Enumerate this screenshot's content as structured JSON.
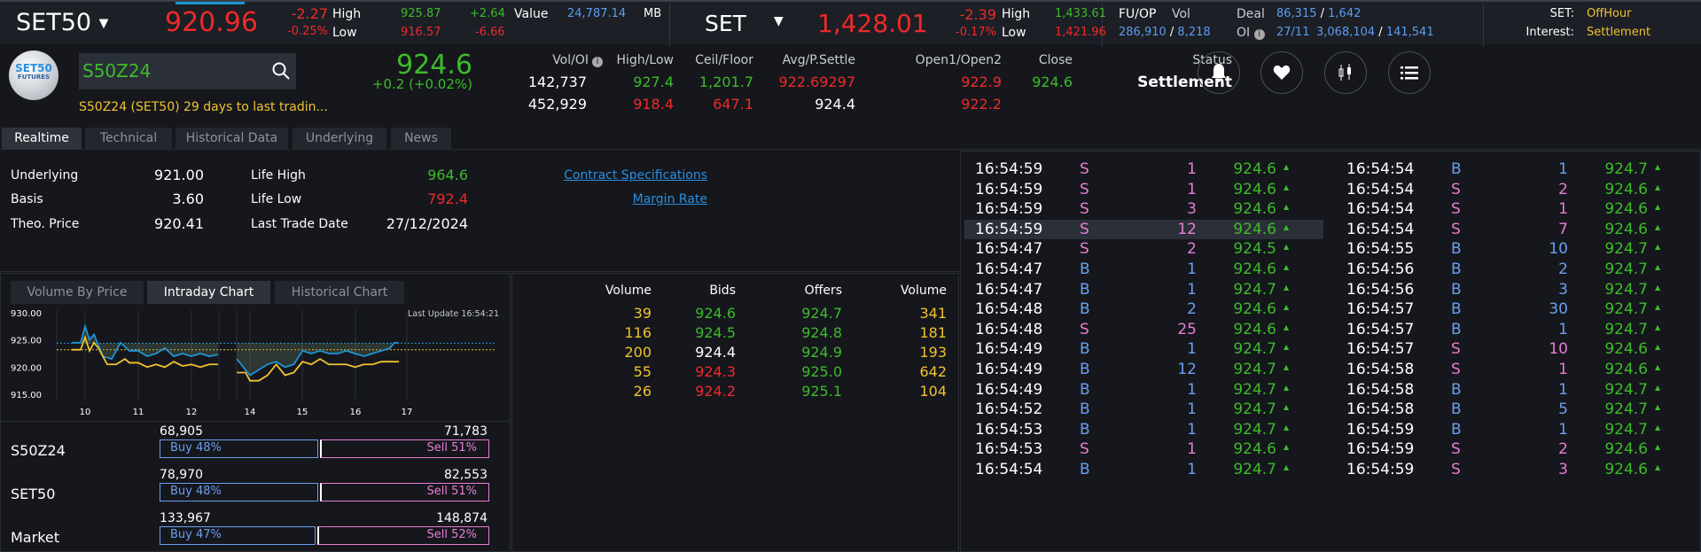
{
  "top": {
    "set50": {
      "name": "SET50",
      "last": "920.96",
      "chg": "-2.27",
      "pct": "-0.25%",
      "high_label": "High",
      "low_label": "Low",
      "high": "925.87",
      "low": "916.57",
      "high_chg": "+2.64",
      "low_chg": "-6.66",
      "value_label": "Value",
      "value": "24,787.14",
      "unit": "MB"
    },
    "set": {
      "name": "SET",
      "last": "1,428.01",
      "chg": "-2.39",
      "pct": "-0.17%",
      "high_label": "High",
      "low_label": "Low",
      "high": "1,433.61",
      "low": "1,421.96"
    },
    "fuop": {
      "label": "FU/OP",
      "vol_label": "Vol",
      "vol": "286,910",
      "vol2": "8,218",
      "deal_label": "Deal",
      "deal": "86,315",
      "deal2": "1,642",
      "oi_label": "OI",
      "oi_date": "27/11",
      "oi": "3,068,104",
      "oi2": "141,541"
    },
    "status": {
      "set_label": "SET:",
      "set_value": "OffHour",
      "interest_label": "Interest:",
      "interest_value": "Settlement"
    }
  },
  "symbol": {
    "logo_top": "SET50",
    "logo_bottom": "FUTURES",
    "search_value": "S50Z24",
    "desc": "S50Z24 (SET50) 29 days to last tradin...",
    "price": "924.6",
    "change": "+0.2 (+0.02%)"
  },
  "stats": {
    "headers": [
      "Vol/OI",
      "High/Low",
      "Ceil/Floor",
      "Avg/P.Settle",
      "Open1/Open2",
      "Close",
      "Status"
    ],
    "vol": "142,737",
    "oi": "452,929",
    "high": "927.4",
    "low": "918.4",
    "ceil": "1,201.7",
    "floor": "647.1",
    "avg": "922.69297",
    "psettle": "924.4",
    "open1": "922.9",
    "open2": "922.2",
    "close": "924.6",
    "status": "Settlement"
  },
  "icons": [
    "bell-icon",
    "heart-icon",
    "candlestick-icon",
    "list-icon"
  ],
  "tabs": [
    "Realtime",
    "Technical",
    "Historical Data",
    "Underlying",
    "News"
  ],
  "info": {
    "underlying_label": "Underlying",
    "underlying": "921.00",
    "basis_label": "Basis",
    "basis": "3.60",
    "theo_label": "Theo. Price",
    "theo": "920.41",
    "life_high_label": "Life High",
    "life_high": "964.6",
    "life_low_label": "Life Low",
    "life_low": "792.4",
    "ltd_label": "Last Trade Date",
    "ltd": "27/12/2024",
    "contract_link": "Contract Specifications",
    "margin_link": "Margin Rate"
  },
  "chart_tabs": [
    "Volume By Price",
    "Intraday Chart",
    "Historical Chart"
  ],
  "chart_data": {
    "type": "line",
    "last_update": "Last Update 16:54:21",
    "ylim": [
      915,
      930
    ],
    "yticks": [
      "930.00",
      "925.00",
      "920.00",
      "915.00"
    ],
    "xticks": [
      "10",
      "11",
      "12",
      "14",
      "15",
      "16",
      "17"
    ],
    "grid": true,
    "colors": {
      "series1": "#1e94d6",
      "series2": "#f2c230"
    },
    "ref_lines": [
      924.4,
      923.2
    ],
    "series": [
      {
        "x": [
          "9:45",
          "9:55",
          "10:00",
          "10:05",
          "10:10",
          "10:15",
          "10:20",
          "10:30",
          "10:40",
          "10:50",
          "11:00",
          "11:10",
          "11:20",
          "11:30",
          "11:40",
          "11:50",
          "12:00",
          "12:10",
          "12:20",
          "12:30",
          null,
          "13:45",
          "13:55",
          "14:00",
          "14:10",
          "14:20",
          "14:30",
          "14:40",
          "14:50",
          "15:00",
          "15:10",
          "15:20",
          "15:30",
          "15:40",
          "15:50",
          "16:00",
          "16:10",
          "16:20",
          "16:30",
          "16:40",
          "16:45",
          "16:50"
        ],
        "values": [
          924.5,
          924.5,
          927.5,
          925,
          926,
          924,
          922,
          921.5,
          924.5,
          923,
          923,
          922,
          922.5,
          923.5,
          922,
          922.5,
          922,
          922.5,
          922,
          922.3,
          null,
          921.5,
          919.5,
          918.5,
          919.5,
          920.5,
          921,
          920,
          920.5,
          923,
          922.5,
          923,
          922.5,
          922.5,
          923,
          922.5,
          922,
          922.5,
          923,
          923.5,
          924.5,
          924.4
        ]
      },
      {
        "x": [
          "9:45",
          "9:55",
          "10:00",
          "10:05",
          "10:10",
          "10:15",
          "10:20",
          "10:25",
          "10:35",
          "10:45",
          "10:50",
          "11:00",
          "11:10",
          "11:20",
          "11:30",
          "11:40",
          "11:50",
          "12:00",
          "12:10",
          "12:20",
          "12:30",
          null,
          "13:45",
          "13:55",
          "14:00",
          "14:10",
          "14:20",
          "14:30",
          "14:40",
          "14:50",
          "15:00",
          "15:10",
          "15:20",
          "15:30",
          "15:40",
          "15:50",
          "16:00",
          "16:10",
          "16:20",
          "16:30",
          "16:40",
          "16:50"
        ],
        "values": [
          923.2,
          923.2,
          925.5,
          923,
          924.5,
          923.5,
          922,
          920.5,
          920.5,
          921.5,
          920.8,
          920.8,
          920,
          920.5,
          920,
          921,
          920.2,
          920.5,
          920,
          920.5,
          920.5,
          null,
          919,
          919,
          917.5,
          917.5,
          918.5,
          920.5,
          918.5,
          919,
          921,
          920.5,
          921.5,
          920.5,
          920.5,
          920.5,
          920,
          920.5,
          920.5,
          921,
          921,
          921
        ]
      }
    ]
  },
  "buysell": [
    {
      "name": "S50Z24",
      "buy_vol": "68,905",
      "sell_vol": "71,783",
      "buy": "Buy 48%",
      "sell": "Sell 51%",
      "buy_pct": 48
    },
    {
      "name": "SET50",
      "buy_vol": "78,970",
      "sell_vol": "82,553",
      "buy": "Buy 48%",
      "sell": "Sell 51%",
      "buy_pct": 48
    },
    {
      "name": "Market",
      "buy_vol": "133,967",
      "sell_vol": "148,874",
      "buy": "Buy 47%",
      "sell": "Sell 52%",
      "buy_pct": 47
    }
  ],
  "orderbook": {
    "headers": [
      "Volume",
      "Bids",
      "Offers",
      "Volume"
    ],
    "rows": [
      {
        "bid_vol": "39",
        "bid": "924.6",
        "bid_color": "#3dbb2a",
        "offer": "924.7",
        "offer_vol": "341"
      },
      {
        "bid_vol": "116",
        "bid": "924.5",
        "bid_color": "#3dbb2a",
        "offer": "924.8",
        "offer_vol": "181"
      },
      {
        "bid_vol": "200",
        "bid": "924.4",
        "bid_color": "#ffffff",
        "offer": "924.9",
        "offer_vol": "193"
      },
      {
        "bid_vol": "55",
        "bid": "924.3",
        "bid_color": "#ee2a2a",
        "offer": "925.0",
        "offer_vol": "642"
      },
      {
        "bid_vol": "26",
        "bid": "924.2",
        "bid_color": "#ee2a2a",
        "offer": "925.1",
        "offer_vol": "104"
      }
    ]
  },
  "ticker": {
    "left": [
      [
        "16:54:59",
        "S",
        "1",
        "924.6"
      ],
      [
        "16:54:59",
        "S",
        "1",
        "924.6"
      ],
      [
        "16:54:59",
        "S",
        "3",
        "924.6"
      ],
      [
        "16:54:59",
        "S",
        "12",
        "924.6"
      ],
      [
        "16:54:47",
        "S",
        "2",
        "924.5"
      ],
      [
        "16:54:47",
        "B",
        "1",
        "924.6"
      ],
      [
        "16:54:47",
        "B",
        "1",
        "924.7"
      ],
      [
        "16:54:48",
        "B",
        "2",
        "924.6"
      ],
      [
        "16:54:48",
        "S",
        "25",
        "924.6"
      ],
      [
        "16:54:49",
        "B",
        "1",
        "924.7"
      ],
      [
        "16:54:49",
        "B",
        "12",
        "924.7"
      ],
      [
        "16:54:49",
        "B",
        "1",
        "924.7"
      ],
      [
        "16:54:52",
        "B",
        "1",
        "924.7"
      ],
      [
        "16:54:53",
        "B",
        "1",
        "924.7"
      ],
      [
        "16:54:53",
        "S",
        "1",
        "924.6"
      ],
      [
        "16:54:54",
        "B",
        "1",
        "924.7"
      ]
    ],
    "right": [
      [
        "16:54:54",
        "B",
        "1",
        "924.7"
      ],
      [
        "16:54:54",
        "S",
        "2",
        "924.6"
      ],
      [
        "16:54:54",
        "S",
        "1",
        "924.6"
      ],
      [
        "16:54:54",
        "S",
        "7",
        "924.6"
      ],
      [
        "16:54:55",
        "B",
        "10",
        "924.7"
      ],
      [
        "16:54:56",
        "B",
        "2",
        "924.7"
      ],
      [
        "16:54:56",
        "B",
        "3",
        "924.7"
      ],
      [
        "16:54:57",
        "B",
        "30",
        "924.7"
      ],
      [
        "16:54:57",
        "B",
        "1",
        "924.7"
      ],
      [
        "16:54:57",
        "S",
        "10",
        "924.6"
      ],
      [
        "16:54:58",
        "S",
        "1",
        "924.6"
      ],
      [
        "16:54:58",
        "B",
        "1",
        "924.7"
      ],
      [
        "16:54:58",
        "B",
        "5",
        "924.7"
      ],
      [
        "16:54:59",
        "B",
        "1",
        "924.7"
      ],
      [
        "16:54:59",
        "S",
        "2",
        "924.6"
      ],
      [
        "16:54:59",
        "S",
        "3",
        "924.6"
      ]
    ],
    "colors": {
      "S": "#e87dd6",
      "B": "#6c9ff0",
      "price": "#3dbb2a"
    },
    "highlight_left": 3
  }
}
